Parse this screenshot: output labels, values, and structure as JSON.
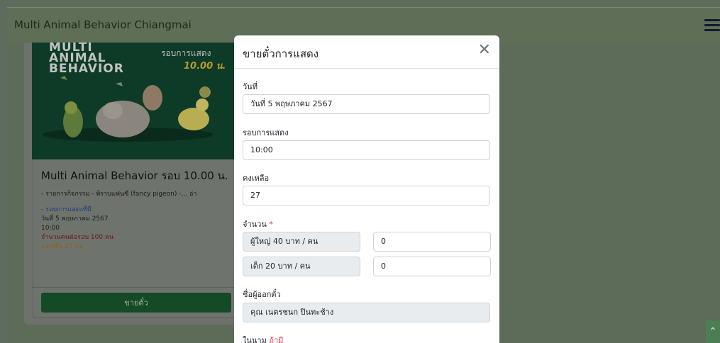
{
  "navbar": {
    "brand": "Multi Animal Behavior Chiangmai",
    "menu_icon": "hamburger-menu-icon"
  },
  "card": {
    "poster": {
      "line1": "MULTI",
      "line2": "ANIMAL",
      "line3": "BEHAVIOR",
      "round_text": "รอบการแสดง",
      "time_text": "10.00 น."
    },
    "title": "Multi Animal Behavior รอบ 10.00 น.",
    "description": "- รายการกิจกรรม - พิราบแฟนซี (fancy pigeon) -... อ่า",
    "show_round_label": "- รอบการแสดงที่มี",
    "date": "วันที่ 5 พฤษภาคม 2567",
    "time": "10:00",
    "capacity": "จำนวนคนต่อรอบ 100 คน",
    "remaining": "คงเหลือ 27 คน",
    "sell_button": "ขายตั๋ว"
  },
  "modal": {
    "title": "ขายตั๋วการแสดง",
    "close_icon": "close-icon",
    "date_label": "วันที่",
    "date_value": "วันที่ 5 พฤษภาคม 2567",
    "round_label": "รอบการแสดง",
    "round_value": "10:00",
    "remaining_label": "คงเหลือ",
    "remaining_value": "27",
    "quantity_label": "จำนวน",
    "required_mark": "*",
    "adult_label": "ผู้ใหญ่ 40 บาท / คน",
    "adult_value": "0",
    "child_label": "เด็ก 20 บาท / คน",
    "child_value": "0",
    "issuer_label": "ชื่อผู้ออกตั๋ว",
    "issuer_value": "คุณ เนตรชนก ปินทะช้าง",
    "on_behalf_label": "ในนาม",
    "on_behalf_optional": "ถ้ามี"
  },
  "scroll_top_icon": "chevron-up-icon"
}
